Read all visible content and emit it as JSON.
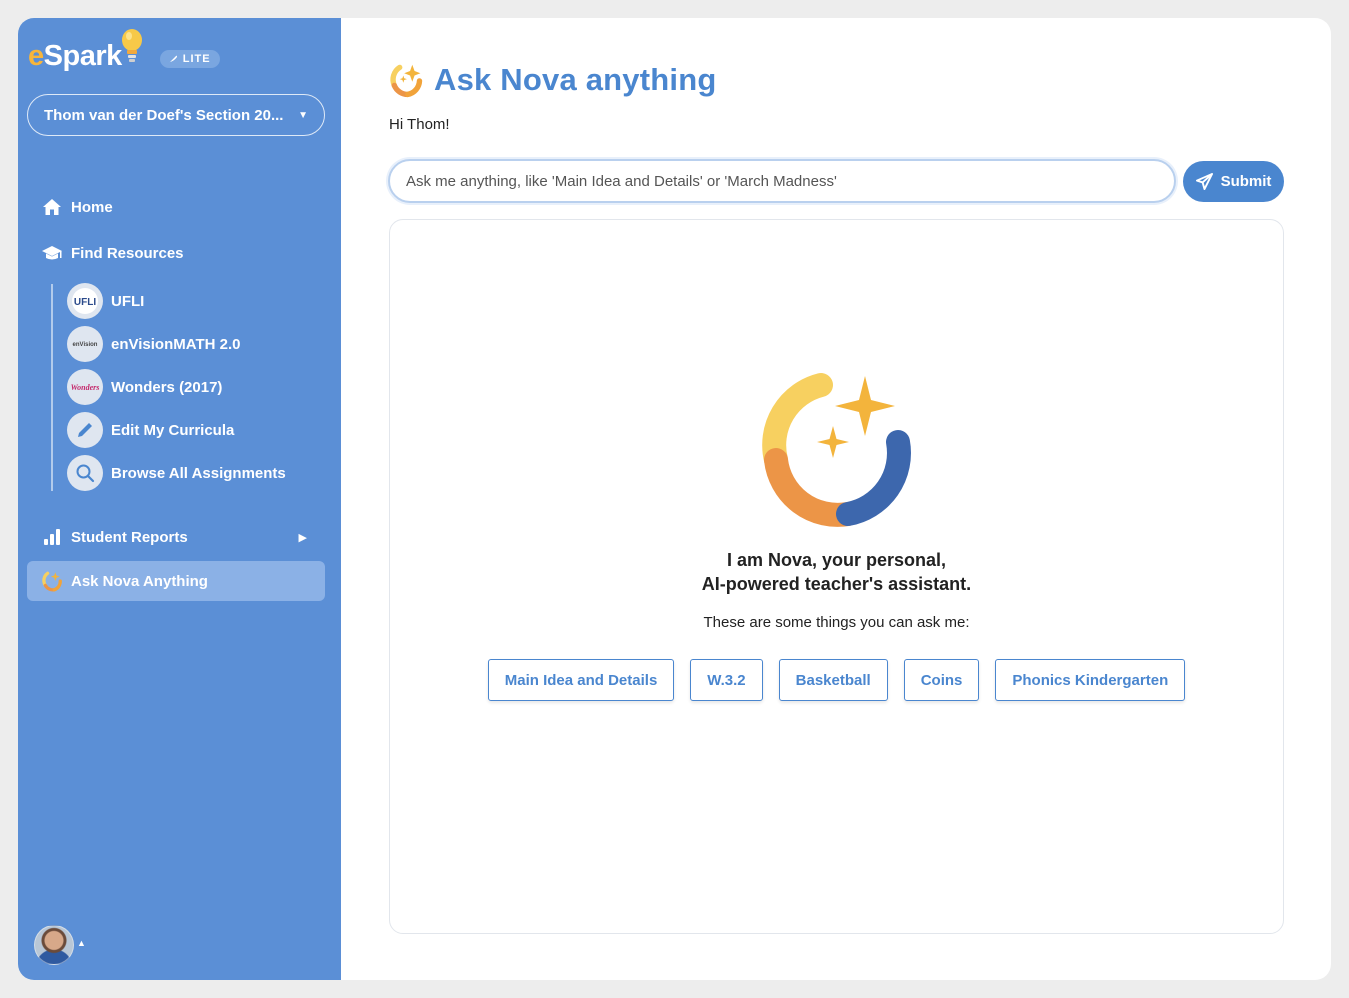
{
  "brand": {
    "logo_e": "e",
    "logo_rest": "Spark",
    "badge": "LITE"
  },
  "section_select": {
    "value": "Thom van der Doef's Section 20..."
  },
  "nav": {
    "home": "Home",
    "find_resources": "Find Resources",
    "sub_items": [
      {
        "label": "UFLI",
        "icon": "ufli-logo"
      },
      {
        "label": "enVisionMATH 2.0",
        "icon": "envision-logo"
      },
      {
        "label": "Wonders (2017)",
        "icon": "wonders-logo"
      },
      {
        "label": "Edit My Curricula",
        "icon": "pencil-icon"
      },
      {
        "label": "Browse All Assignments",
        "icon": "magnifier-icon"
      }
    ],
    "student_reports": "Student Reports",
    "ask_nova": "Ask Nova Anything"
  },
  "main": {
    "title": "Ask Nova anything",
    "greeting": "Hi Thom!",
    "search_placeholder": "Ask me anything, like 'Main Idea and Details' or 'March Madness'",
    "submit_label": "Submit",
    "intro_line1": "I am Nova, your personal,",
    "intro_line2": "AI-powered teacher's assistant.",
    "hint": "These are some things you can ask me:",
    "suggestions": [
      "Main Idea and Details",
      "W.3.2",
      "Basketball",
      "Coins",
      "Phonics Kindergarten"
    ]
  },
  "colors": {
    "sidebar": "#5b8fd6",
    "accent": "#4a86cf",
    "active_nav": "#8bb1e6",
    "nova_yellow": "#f7d060",
    "nova_orange": "#ec9547",
    "nova_blue": "#3d67ad",
    "star": "#f3b43c"
  }
}
